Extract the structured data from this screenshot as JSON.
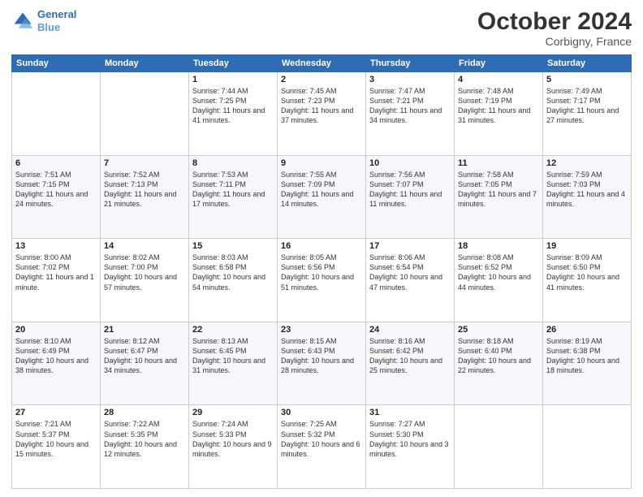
{
  "header": {
    "logo_line1": "General",
    "logo_line2": "Blue",
    "month": "October 2024",
    "location": "Corbigny, France"
  },
  "days_of_week": [
    "Sunday",
    "Monday",
    "Tuesday",
    "Wednesday",
    "Thursday",
    "Friday",
    "Saturday"
  ],
  "weeks": [
    [
      {
        "day": "",
        "sunrise": "",
        "sunset": "",
        "daylight": ""
      },
      {
        "day": "",
        "sunrise": "",
        "sunset": "",
        "daylight": ""
      },
      {
        "day": "1",
        "sunrise": "Sunrise: 7:44 AM",
        "sunset": "Sunset: 7:25 PM",
        "daylight": "Daylight: 11 hours and 41 minutes."
      },
      {
        "day": "2",
        "sunrise": "Sunrise: 7:45 AM",
        "sunset": "Sunset: 7:23 PM",
        "daylight": "Daylight: 11 hours and 37 minutes."
      },
      {
        "day": "3",
        "sunrise": "Sunrise: 7:47 AM",
        "sunset": "Sunset: 7:21 PM",
        "daylight": "Daylight: 11 hours and 34 minutes."
      },
      {
        "day": "4",
        "sunrise": "Sunrise: 7:48 AM",
        "sunset": "Sunset: 7:19 PM",
        "daylight": "Daylight: 11 hours and 31 minutes."
      },
      {
        "day": "5",
        "sunrise": "Sunrise: 7:49 AM",
        "sunset": "Sunset: 7:17 PM",
        "daylight": "Daylight: 11 hours and 27 minutes."
      }
    ],
    [
      {
        "day": "6",
        "sunrise": "Sunrise: 7:51 AM",
        "sunset": "Sunset: 7:15 PM",
        "daylight": "Daylight: 11 hours and 24 minutes."
      },
      {
        "day": "7",
        "sunrise": "Sunrise: 7:52 AM",
        "sunset": "Sunset: 7:13 PM",
        "daylight": "Daylight: 11 hours and 21 minutes."
      },
      {
        "day": "8",
        "sunrise": "Sunrise: 7:53 AM",
        "sunset": "Sunset: 7:11 PM",
        "daylight": "Daylight: 11 hours and 17 minutes."
      },
      {
        "day": "9",
        "sunrise": "Sunrise: 7:55 AM",
        "sunset": "Sunset: 7:09 PM",
        "daylight": "Daylight: 11 hours and 14 minutes."
      },
      {
        "day": "10",
        "sunrise": "Sunrise: 7:56 AM",
        "sunset": "Sunset: 7:07 PM",
        "daylight": "Daylight: 11 hours and 11 minutes."
      },
      {
        "day": "11",
        "sunrise": "Sunrise: 7:58 AM",
        "sunset": "Sunset: 7:05 PM",
        "daylight": "Daylight: 11 hours and 7 minutes."
      },
      {
        "day": "12",
        "sunrise": "Sunrise: 7:59 AM",
        "sunset": "Sunset: 7:03 PM",
        "daylight": "Daylight: 11 hours and 4 minutes."
      }
    ],
    [
      {
        "day": "13",
        "sunrise": "Sunrise: 8:00 AM",
        "sunset": "Sunset: 7:02 PM",
        "daylight": "Daylight: 11 hours and 1 minute."
      },
      {
        "day": "14",
        "sunrise": "Sunrise: 8:02 AM",
        "sunset": "Sunset: 7:00 PM",
        "daylight": "Daylight: 10 hours and 57 minutes."
      },
      {
        "day": "15",
        "sunrise": "Sunrise: 8:03 AM",
        "sunset": "Sunset: 6:58 PM",
        "daylight": "Daylight: 10 hours and 54 minutes."
      },
      {
        "day": "16",
        "sunrise": "Sunrise: 8:05 AM",
        "sunset": "Sunset: 6:56 PM",
        "daylight": "Daylight: 10 hours and 51 minutes."
      },
      {
        "day": "17",
        "sunrise": "Sunrise: 8:06 AM",
        "sunset": "Sunset: 6:54 PM",
        "daylight": "Daylight: 10 hours and 47 minutes."
      },
      {
        "day": "18",
        "sunrise": "Sunrise: 8:08 AM",
        "sunset": "Sunset: 6:52 PM",
        "daylight": "Daylight: 10 hours and 44 minutes."
      },
      {
        "day": "19",
        "sunrise": "Sunrise: 8:09 AM",
        "sunset": "Sunset: 6:50 PM",
        "daylight": "Daylight: 10 hours and 41 minutes."
      }
    ],
    [
      {
        "day": "20",
        "sunrise": "Sunrise: 8:10 AM",
        "sunset": "Sunset: 6:49 PM",
        "daylight": "Daylight: 10 hours and 38 minutes."
      },
      {
        "day": "21",
        "sunrise": "Sunrise: 8:12 AM",
        "sunset": "Sunset: 6:47 PM",
        "daylight": "Daylight: 10 hours and 34 minutes."
      },
      {
        "day": "22",
        "sunrise": "Sunrise: 8:13 AM",
        "sunset": "Sunset: 6:45 PM",
        "daylight": "Daylight: 10 hours and 31 minutes."
      },
      {
        "day": "23",
        "sunrise": "Sunrise: 8:15 AM",
        "sunset": "Sunset: 6:43 PM",
        "daylight": "Daylight: 10 hours and 28 minutes."
      },
      {
        "day": "24",
        "sunrise": "Sunrise: 8:16 AM",
        "sunset": "Sunset: 6:42 PM",
        "daylight": "Daylight: 10 hours and 25 minutes."
      },
      {
        "day": "25",
        "sunrise": "Sunrise: 8:18 AM",
        "sunset": "Sunset: 6:40 PM",
        "daylight": "Daylight: 10 hours and 22 minutes."
      },
      {
        "day": "26",
        "sunrise": "Sunrise: 8:19 AM",
        "sunset": "Sunset: 6:38 PM",
        "daylight": "Daylight: 10 hours and 18 minutes."
      }
    ],
    [
      {
        "day": "27",
        "sunrise": "Sunrise: 7:21 AM",
        "sunset": "Sunset: 5:37 PM",
        "daylight": "Daylight: 10 hours and 15 minutes."
      },
      {
        "day": "28",
        "sunrise": "Sunrise: 7:22 AM",
        "sunset": "Sunset: 5:35 PM",
        "daylight": "Daylight: 10 hours and 12 minutes."
      },
      {
        "day": "29",
        "sunrise": "Sunrise: 7:24 AM",
        "sunset": "Sunset: 5:33 PM",
        "daylight": "Daylight: 10 hours and 9 minutes."
      },
      {
        "day": "30",
        "sunrise": "Sunrise: 7:25 AM",
        "sunset": "Sunset: 5:32 PM",
        "daylight": "Daylight: 10 hours and 6 minutes."
      },
      {
        "day": "31",
        "sunrise": "Sunrise: 7:27 AM",
        "sunset": "Sunset: 5:30 PM",
        "daylight": "Daylight: 10 hours and 3 minutes."
      },
      {
        "day": "",
        "sunrise": "",
        "sunset": "",
        "daylight": ""
      },
      {
        "day": "",
        "sunrise": "",
        "sunset": "",
        "daylight": ""
      }
    ]
  ]
}
